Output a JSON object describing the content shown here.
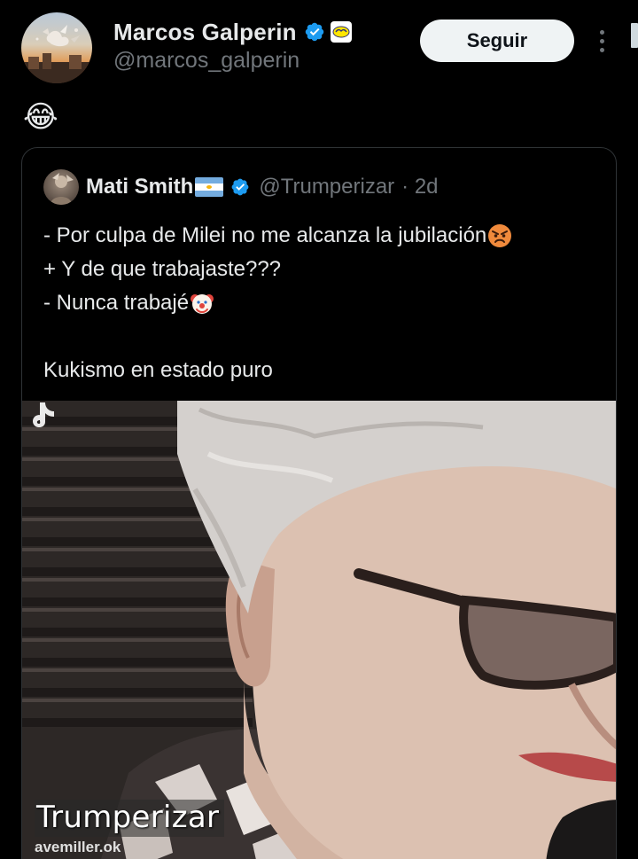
{
  "author": {
    "display_name": "Marcos Galperin",
    "handle": "@marcos_galperin",
    "follow_label": "Seguir",
    "verified_color": "#1d9bf0"
  },
  "tweet": {
    "text": "😂"
  },
  "quoted": {
    "display_name": "Mati Smith",
    "handle": "@Trumperizar",
    "time": "· 2d",
    "lines": [
      "- Por culpa de Milei no me alcanza la jubilación",
      "+ Y de que trabajaste???",
      "- Nunca trabajé",
      "",
      "Kukismo en estado puro"
    ],
    "video": {
      "watermark_text": "Trumperizar",
      "watermark_user": "avemiller.ok"
    }
  },
  "colors": {
    "background": "#000000",
    "text": "#e7e9ea",
    "muted": "#71767b",
    "border": "#2f3336",
    "button_bg": "#eff3f4"
  },
  "icons": {
    "verified": "verified-badge-icon",
    "affiliate": "affiliate-badge-icon",
    "more": "more-options-icon",
    "flag": "argentina-flag-icon",
    "angry": "angry-face-emoji",
    "clown": "clown-face-emoji",
    "laugh": "tears-of-joy-emoji"
  }
}
